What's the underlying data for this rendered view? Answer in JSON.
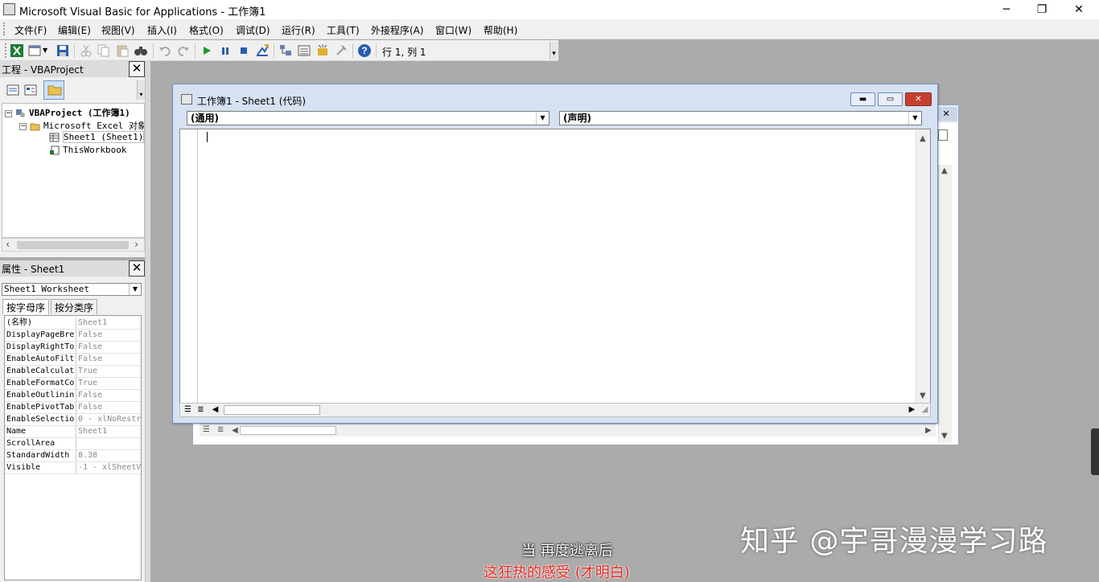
{
  "window": {
    "title": "Microsoft Visual Basic for Applications - 工作簿1",
    "controls": {
      "minimize": "─",
      "restore": "❐",
      "close": "✕"
    }
  },
  "menu": [
    "文件(F)",
    "编辑(E)",
    "视图(V)",
    "插入(I)",
    "格式(O)",
    "调试(D)",
    "运行(R)",
    "工具(T)",
    "外接程序(A)",
    "窗口(W)",
    "帮助(H)"
  ],
  "toolbar": {
    "status": "行 1, 列 1",
    "icons": [
      "excel-view-icon",
      "insert-module-icon",
      "save-icon",
      "cut-icon",
      "copy-icon",
      "paste-icon",
      "find-icon",
      "undo-icon",
      "redo-icon",
      "run-icon",
      "break-icon",
      "reset-icon",
      "design-mode-icon",
      "project-explorer-icon",
      "properties-icon",
      "object-browser-icon",
      "toolbox-icon",
      "help-icon"
    ]
  },
  "project_pane": {
    "title": "工程 - VBAProject",
    "close": "✕",
    "tree": [
      {
        "label": "VBAProject (工作簿1)",
        "toggle": "−"
      },
      {
        "label": "Microsoft Excel 对象",
        "toggle": "−"
      },
      {
        "label": "Sheet1 (Sheet1)"
      },
      {
        "label": "ThisWorkbook"
      }
    ],
    "scroll_left": "‹",
    "scroll_right": "›"
  },
  "props_pane": {
    "title": "属性 - Sheet1",
    "close": "✕",
    "object_select": "Sheet1 Worksheet",
    "tabs": [
      "按字母序",
      "按分类序"
    ],
    "rows": [
      {
        "name": "(名称)",
        "value": "Sheet1"
      },
      {
        "name": "DisplayPageBre",
        "value": "False"
      },
      {
        "name": "DisplayRightTo",
        "value": "False"
      },
      {
        "name": "EnableAutoFilt",
        "value": "False"
      },
      {
        "name": "EnableCalculat",
        "value": "True"
      },
      {
        "name": "EnableFormatCo",
        "value": "True"
      },
      {
        "name": "EnableOutlinin",
        "value": "False"
      },
      {
        "name": "EnablePivotTab",
        "value": "False"
      },
      {
        "name": "EnableSelectio",
        "value": "0 - xlNoRestr"
      },
      {
        "name": "Name",
        "value": "Sheet1"
      },
      {
        "name": "ScrollArea",
        "value": ""
      },
      {
        "name": "StandardWidth",
        "value": "8.38"
      },
      {
        "name": "Visible",
        "value": "-1 - xlSheetV"
      }
    ]
  },
  "code_window": {
    "title": "工作簿1 - Sheet1 (代码)",
    "object_combo": "(通用)",
    "proc_combo": "(声明)",
    "buttons": {
      "minimize": "▬",
      "restore": "▭",
      "close": "✕"
    }
  },
  "overlays": {
    "subtitle_line1": "当 再度逃离后",
    "subtitle_line2": "这狂热的感受 (才明白)",
    "watermark": "知乎 @宇哥漫漫学习路"
  },
  "colors": {
    "workspace": "#ababab",
    "code_window_frame": "#d6e2f2",
    "close_button": "#c7402f",
    "subtitle_red": "#e8261c"
  }
}
